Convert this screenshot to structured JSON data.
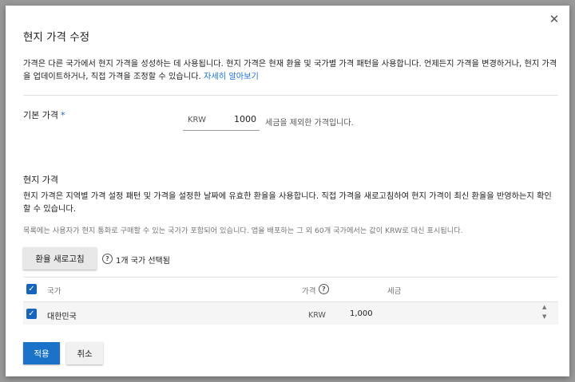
{
  "dialog": {
    "title": "현지 가격 수정",
    "close_icon": "close-icon",
    "intro_text": "가격은 다른 국가에서 현지 가격을 성성하는 데 사용됩니다. 현지 가격은 현재 환율 및 국가별 가격 패턴을 사용합니다. 언제든지 가격을 변경하거나, 현지 가격을 업데이트하거나, 직접 가격을 조정할 수 있습니다.",
    "learn_more_link": "자세히 알아보기"
  },
  "base_price": {
    "label": "기본 가격",
    "required_mark": "*",
    "currency": "KRW",
    "value": "1000",
    "note": "세금을 제외한 가격입니다."
  },
  "local_price": {
    "title": "현지 가격",
    "description": "현지 가격은 지역별 가격 설정 패턴 및 가격을 설정한 날짜에 유효한 환율을 사용합니다. 직접 가격을 새로고침하여 현지 가격이 최신 환율을 반영하는지 확인할 수 있습니다.",
    "note": "목록에는 사용자가 현지 통화로 구매할 수 있는 국가가 포함되어 있습니다. 앱을 배포하는 그 외 60개 국가에서는 값이 KRW로 대신 표시됩니다.",
    "refresh_button": "환율 새로고침",
    "selected_count": "1개 국가 선택됨",
    "help_icon": "help-icon"
  },
  "table": {
    "headers": {
      "country": "국가",
      "price": "가격",
      "tax": "세금"
    },
    "rows": [
      {
        "country": "대한민국",
        "currency": "KRW",
        "price": "1,000",
        "checked": true
      }
    ]
  },
  "footer": {
    "apply_button": "적용",
    "cancel_button": "취소"
  },
  "colors": {
    "accent": "#1a73c9",
    "link": "#1a73e8",
    "backdrop": "#9a9a9a"
  }
}
